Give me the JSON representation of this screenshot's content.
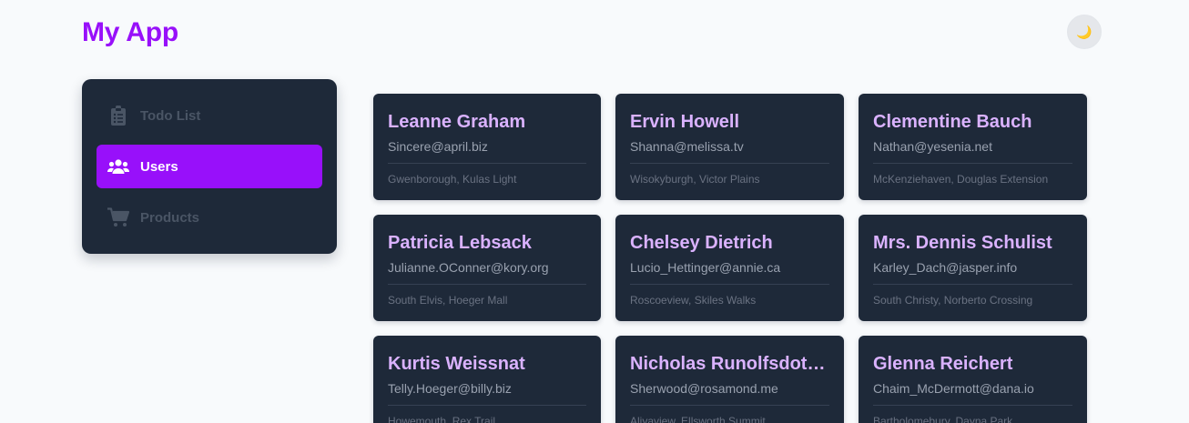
{
  "app": {
    "title": "My App"
  },
  "header": {
    "theme_toggle": {
      "icon": "moon-icon",
      "glyph": "🌙"
    }
  },
  "sidebar": {
    "items": [
      {
        "label": "Todo List",
        "icon": "clipboard-icon",
        "active": false
      },
      {
        "label": "Users",
        "icon": "users-icon",
        "active": true
      },
      {
        "label": "Products",
        "icon": "shopping-cart-icon",
        "active": false
      }
    ]
  },
  "colors": {
    "accent": "#9810fa",
    "panel": "#1e2939",
    "name": "#dab2ff",
    "nav_inactive": "#4a5565"
  },
  "users": [
    {
      "name": "Leanne Graham",
      "email": "Sincere@april.biz",
      "address": "Gwenborough, Kulas Light"
    },
    {
      "name": "Ervin Howell",
      "email": "Shanna@melissa.tv",
      "address": "Wisokyburgh, Victor Plains"
    },
    {
      "name": "Clementine Bauch",
      "email": "Nathan@yesenia.net",
      "address": "McKenziehaven, Douglas Extension"
    },
    {
      "name": "Patricia Lebsack",
      "email": "Julianne.OConner@kory.org",
      "address": "South Elvis, Hoeger Mall"
    },
    {
      "name": "Chelsey Dietrich",
      "email": "Lucio_Hettinger@annie.ca",
      "address": "Roscoeview, Skiles Walks"
    },
    {
      "name": "Mrs. Dennis Schulist",
      "email": "Karley_Dach@jasper.info",
      "address": "South Christy, Norberto Crossing"
    },
    {
      "name": "Kurtis Weissnat",
      "email": "Telly.Hoeger@billy.biz",
      "address": "Howemouth, Rex Trail"
    },
    {
      "name": "Nicholas Runolfsdottir V",
      "email": "Sherwood@rosamond.me",
      "address": "Aliyaview, Ellsworth Summit"
    },
    {
      "name": "Glenna Reichert",
      "email": "Chaim_McDermott@dana.io",
      "address": "Bartholomebury, Dayna Park"
    }
  ]
}
